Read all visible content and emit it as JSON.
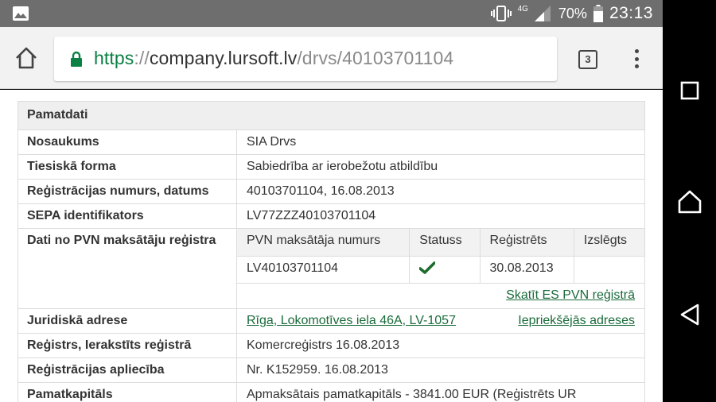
{
  "status_bar": {
    "network": "4G",
    "battery": "70%",
    "time": "23:13"
  },
  "browser": {
    "url_scheme": "https",
    "url_sep": "://",
    "url_host": "company.lursoft.lv",
    "url_path": "/drvs/40103701104",
    "tab_count": "3"
  },
  "section": {
    "title": "Pamatdati"
  },
  "rows": [
    {
      "label": "Nosaukums",
      "value": "SIA Drvs"
    },
    {
      "label": "Tiesiskā forma",
      "value": "Sabiedrība ar ierobežotu atbildību"
    },
    {
      "label": "Reģistrācijas numurs, datums",
      "value": "40103701104, 16.08.2013"
    },
    {
      "label": "SEPA identifikators",
      "value": "LV77ZZZ40103701104"
    }
  ],
  "pvn": {
    "label": "Dati no PVN maksātāju reģistra",
    "headers": [
      "PVN maksātāja numurs",
      "Statuss",
      "Reģistrēts",
      "Izslēgts"
    ],
    "row": {
      "number": "LV40103701104",
      "status": "active",
      "registered": "30.08.2013",
      "excluded": ""
    },
    "es_link": "Skatīt ES PVN reģistrā"
  },
  "address": {
    "label": "Juridiskā adrese",
    "value": "Rīga, Lokomotīves iela 46A, LV-1057",
    "prev_link": "Iepriekšējās adreses"
  },
  "rows2": [
    {
      "label": "Reģistrs, Ierakstīts reģistrā",
      "value": "Komercreģistrs 16.08.2013"
    },
    {
      "label": "Reģistrācijas apliecība",
      "value": "Nr. K152959. 16.08.2013"
    },
    {
      "label": "Pamatkapitāls",
      "value": "Apmaksātais pamatkapitāls - 3841.00 EUR (Reģistrēts UR"
    }
  ],
  "colors": {
    "status_bar": "#6e6e6e",
    "link": "#1a6b3a",
    "secure": "#0b8043",
    "check": "#1e6b2e"
  }
}
